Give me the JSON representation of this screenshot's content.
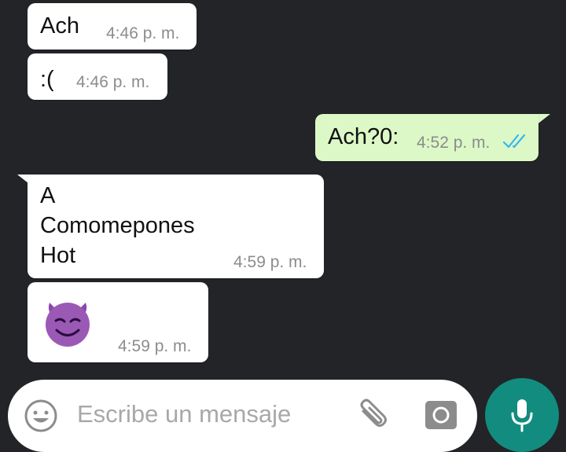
{
  "messages": [
    {
      "direction": "incoming",
      "text": "Ach",
      "time": "4:46 p. m."
    },
    {
      "direction": "incoming",
      "text": ":(",
      "time": "4:46 p. m."
    },
    {
      "direction": "outgoing",
      "text": "Ach?0:",
      "time": "4:52 p. m.",
      "status": "read",
      "status_icon": "double-check-icon",
      "status_color": "#34b7f1"
    },
    {
      "direction": "incoming",
      "text": "A\nComomepones\nHot",
      "time": "4:59 p. m."
    },
    {
      "direction": "incoming",
      "text": "😈",
      "time": "4:59 p. m."
    }
  ],
  "composer": {
    "placeholder": "Escribe un mensaje",
    "emoji_icon": "emoji-icon",
    "attach_icon": "paperclip-icon",
    "camera_icon": "camera-icon",
    "mic_icon": "mic-icon"
  },
  "colors": {
    "background": "#222428",
    "incoming_bubble": "#ffffff",
    "outgoing_bubble": "#dcf8c6",
    "mic_button": "#128c7e"
  }
}
